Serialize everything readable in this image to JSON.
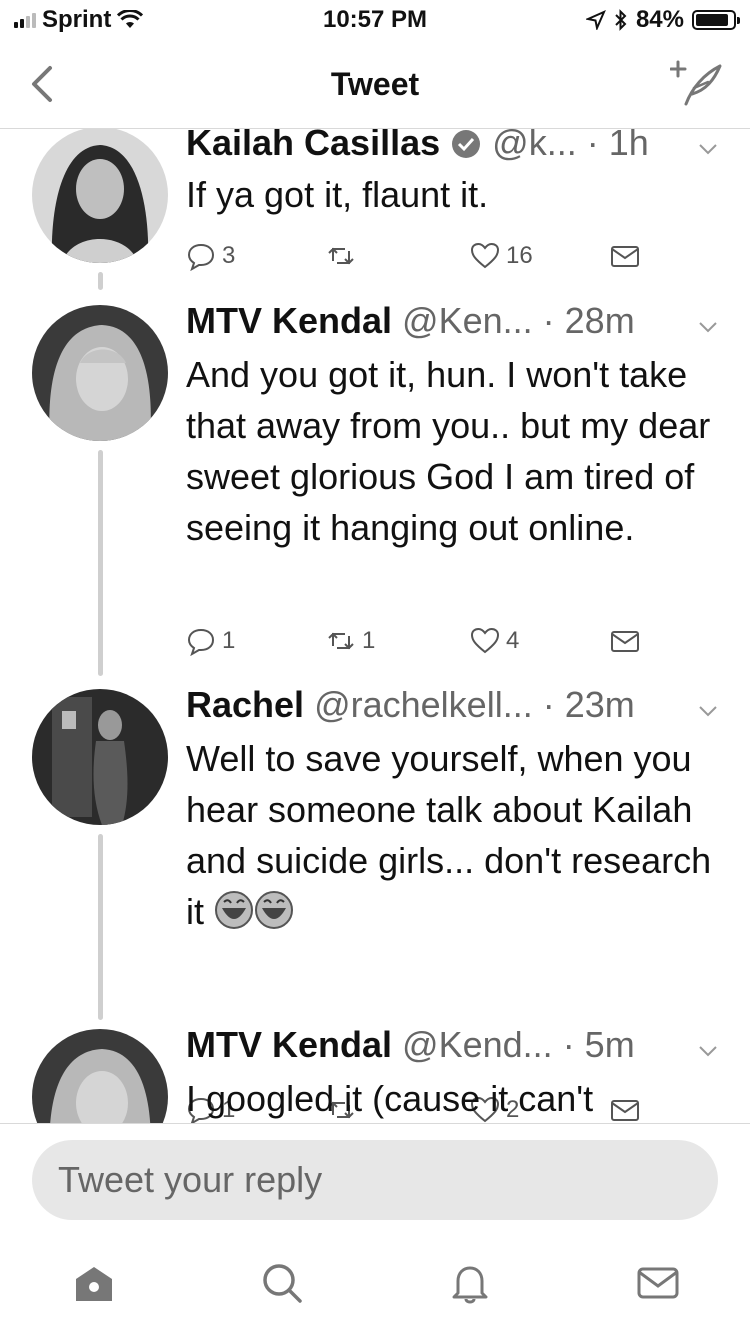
{
  "status_bar": {
    "carrier": "Sprint",
    "time": "10:57 PM",
    "battery": "84%"
  },
  "nav": {
    "title": "Tweet",
    "back_icon": "chevron-left-icon",
    "compose_icon": "compose-tweet-icon"
  },
  "tweets": [
    {
      "name": "Kailah Casillas",
      "verified": true,
      "handle": "@k...",
      "time": "· 1h",
      "text": "If ya got it, flaunt it.",
      "replies": "3",
      "retweets": "",
      "likes": "16"
    },
    {
      "name": "MTV Kendal",
      "verified": false,
      "handle": "@Ken...",
      "time": "· 28m",
      "text": "And you got it, hun. I won't take that away from you.. but my dear sweet glorious God I am tired of seeing it hanging out online.",
      "replies": "1",
      "retweets": "1",
      "likes": "4"
    },
    {
      "name": "Rachel",
      "verified": false,
      "handle": "@rachelkell...",
      "time": "· 23m",
      "text": "Well to save yourself, when you hear someone talk about Kailah and suicide girls... don't research it",
      "emoji": "😂😂",
      "replies": "1",
      "retweets": "",
      "likes": "2"
    },
    {
      "name": "MTV Kendal",
      "verified": false,
      "handle": "@Kend...",
      "time": "· 5m",
      "text": "I googled it (cause it can't"
    }
  ],
  "reply": {
    "placeholder": "Tweet your reply"
  },
  "tabbar": {
    "items": [
      "home-icon",
      "search-icon",
      "notifications-icon",
      "messages-icon"
    ]
  }
}
